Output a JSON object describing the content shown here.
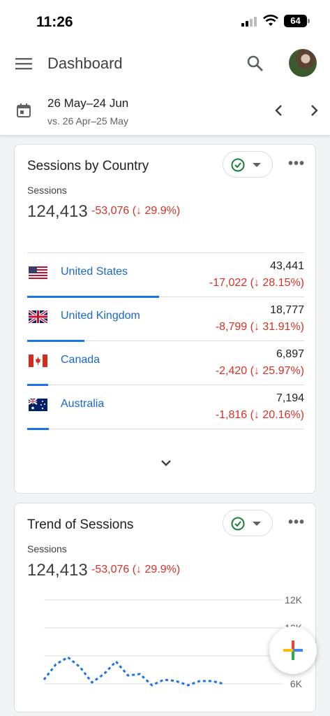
{
  "status": {
    "time": "11:26",
    "battery": "64"
  },
  "header": {
    "title": "Dashboard"
  },
  "date": {
    "range": "26 May–24 Jun",
    "compare": "vs. 26 Apr–25 May"
  },
  "card_country": {
    "title": "Sessions by Country",
    "metric_label": "Sessions",
    "metric_value": "124,413",
    "metric_delta": "-53,076 (↓ 29.9%)",
    "rows": [
      {
        "country": "United States",
        "value": "43,441",
        "delta": "-17,022 (↓ 28.15%)",
        "share": 0.4762,
        "flag": "us-flag"
      },
      {
        "country": "United Kingdom",
        "value": "18,777",
        "delta": "-8,799 (↓ 31.91%)",
        "share": 0.2058,
        "flag": "uk-flag"
      },
      {
        "country": "Canada",
        "value": "6,897",
        "delta": "-2,420 (↓ 25.97%)",
        "share": 0.0756,
        "flag": "canada-flag"
      },
      {
        "country": "Australia",
        "value": "7,194",
        "delta": "-1,816 (↓ 20.16%)",
        "share": 0.0789,
        "flag": "australia-flag"
      }
    ]
  },
  "card_trend": {
    "title": "Trend of Sessions",
    "metric_label": "Sessions",
    "metric_value": "124,413",
    "metric_delta": "-53,076 (↓ 29.9%)"
  },
  "chart_data": {
    "type": "line",
    "y_ticks": [
      "12K",
      "10K",
      "8K",
      "6K"
    ],
    "ylim": [
      6000,
      12000
    ],
    "series": [
      {
        "values": [
          6300,
          7400,
          7900,
          7200,
          6100,
          6700,
          7600,
          6600,
          6700,
          5900,
          6300,
          6200,
          5900,
          6200,
          6200,
          6000
        ]
      }
    ]
  },
  "colors": {
    "accent": "#1a73e8",
    "negative": "#d93025",
    "link": "#1967d2",
    "check": "#188038"
  }
}
